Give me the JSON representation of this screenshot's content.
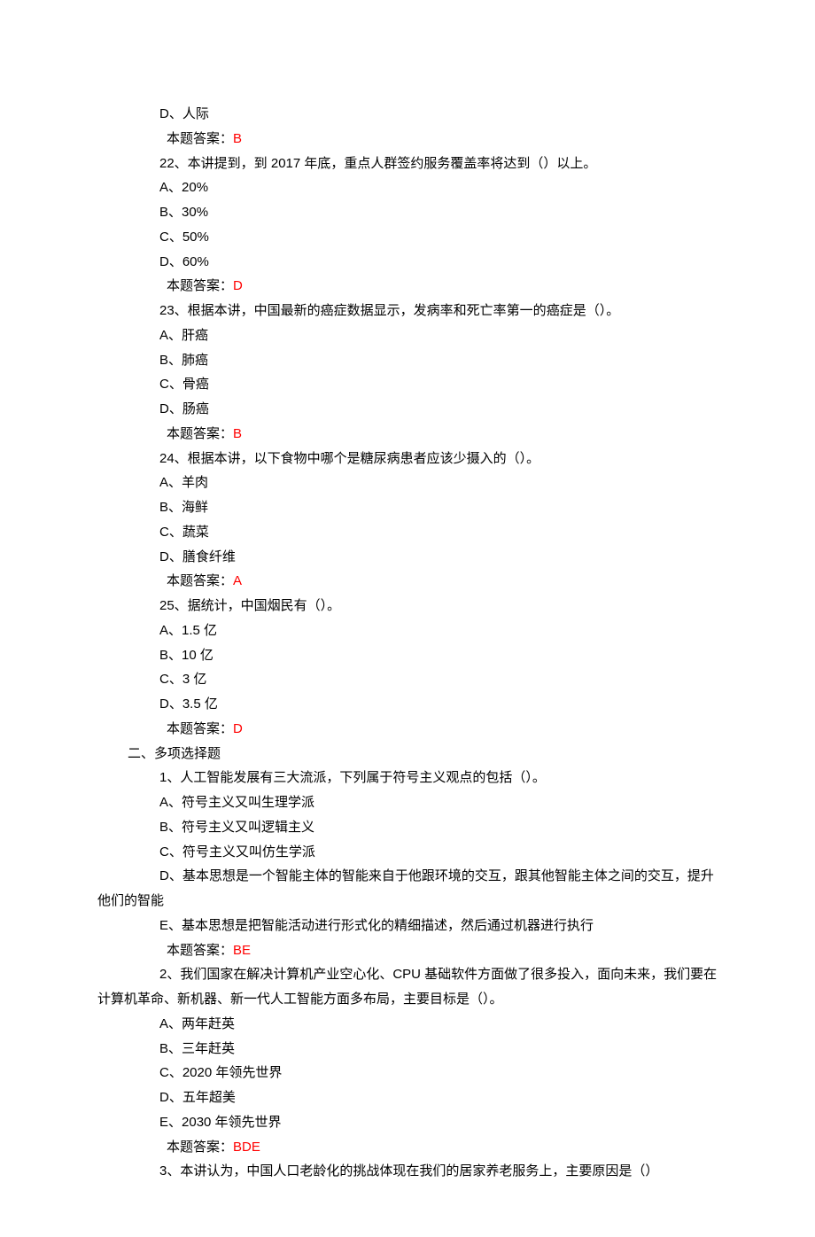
{
  "colors": {
    "answer": "#ff0000"
  },
  "lines": [
    {
      "cls": "indent1",
      "text": "D、人际"
    },
    {
      "cls": "indent2 ans",
      "label": "本题答案：",
      "value": "B"
    },
    {
      "cls": "indent1",
      "text": "22、本讲提到，到 2017 年底，重点人群签约服务覆盖率将达到（）以上。"
    },
    {
      "cls": "indent1",
      "text": "A、20%"
    },
    {
      "cls": "indent1",
      "text": "B、30%"
    },
    {
      "cls": "indent1",
      "text": "C、50%"
    },
    {
      "cls": "indent1",
      "text": "D、60%"
    },
    {
      "cls": "indent2 ans",
      "label": "本题答案：",
      "value": "D"
    },
    {
      "cls": "indent1",
      "text": "23、根据本讲，中国最新的癌症数据显示，发病率和死亡率第一的癌症是（）。"
    },
    {
      "cls": "indent1",
      "text": "A、肝癌"
    },
    {
      "cls": "indent1",
      "text": "B、肺癌"
    },
    {
      "cls": "indent1",
      "text": "C、骨癌"
    },
    {
      "cls": "indent1",
      "text": "D、肠癌"
    },
    {
      "cls": "indent2 ans",
      "label": "本题答案：",
      "value": "B"
    },
    {
      "cls": "indent1",
      "text": "24、根据本讲，以下食物中哪个是糖尿病患者应该少摄入的（）。"
    },
    {
      "cls": "indent1",
      "text": "A、羊肉"
    },
    {
      "cls": "indent1",
      "text": "B、海鲜"
    },
    {
      "cls": "indent1",
      "text": "C、蔬菜"
    },
    {
      "cls": "indent1",
      "text": "D、膳食纤维"
    },
    {
      "cls": "indent2 ans",
      "label": "本题答案：",
      "value": "A"
    },
    {
      "cls": "indent1",
      "text": "25、据统计，中国烟民有（）。"
    },
    {
      "cls": "indent1",
      "text": "A、1.5 亿"
    },
    {
      "cls": "indent1",
      "text": "B、10 亿"
    },
    {
      "cls": "indent1",
      "text": "C、3 亿"
    },
    {
      "cls": "indent1",
      "text": "D、3.5 亿"
    },
    {
      "cls": "indent2 ans",
      "label": "本题答案：",
      "value": "D"
    },
    {
      "cls": "indent0",
      "text": "二、多项选择题"
    },
    {
      "cls": "indent1",
      "text": "1、人工智能发展有三大流派，下列属于符号主义观点的包括（）。"
    },
    {
      "cls": "indent1",
      "text": "A、符号主义又叫生理学派"
    },
    {
      "cls": "indent1",
      "text": "B、符号主义又叫逻辑主义"
    },
    {
      "cls": "indent1",
      "text": "C、符号主义又叫仿生学派"
    },
    {
      "cls": "indent1 wrap",
      "text": "D、基本思想是一个智能主体的智能来自于他跟环境的交互，跟其他智能主体之间的交互，提升他们的智能"
    },
    {
      "cls": "indent1",
      "text": "E、基本思想是把智能活动进行形式化的精细描述，然后通过机器进行执行"
    },
    {
      "cls": "indent2 ans",
      "label": "本题答案：",
      "value": "BE"
    },
    {
      "cls": "indent1 wrap",
      "text": "2、我们国家在解决计算机产业空心化、CPU 基础软件方面做了很多投入，面向未来，我们要在计算机革命、新机器、新一代人工智能方面多布局，主要目标是（）。"
    },
    {
      "cls": "indent1",
      "text": "A、两年赶英"
    },
    {
      "cls": "indent1",
      "text": "B、三年赶英"
    },
    {
      "cls": "indent1",
      "text": "C、2020 年领先世界"
    },
    {
      "cls": "indent1",
      "text": "D、五年超美"
    },
    {
      "cls": "indent1",
      "text": "E、2030 年领先世界"
    },
    {
      "cls": "indent2 ans",
      "label": "本题答案：",
      "value": "BDE"
    },
    {
      "cls": "indent1",
      "text": "3、本讲认为，中国人口老龄化的挑战体现在我们的居家养老服务上，主要原因是（）"
    }
  ]
}
